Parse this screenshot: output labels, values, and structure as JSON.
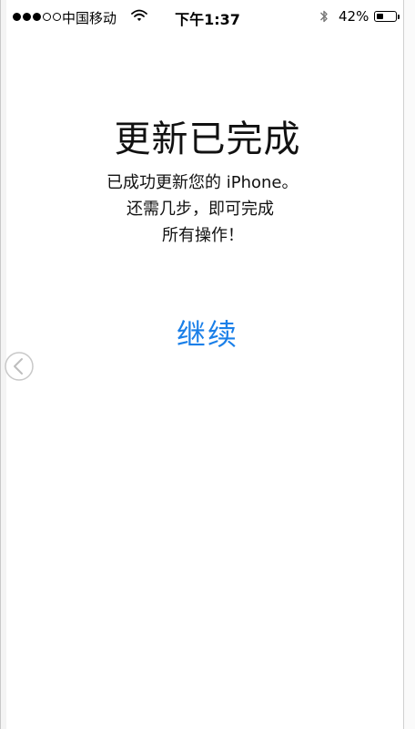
{
  "status_bar": {
    "signal_filled": 3,
    "signal_total": 5,
    "carrier": "中国移动",
    "time": "下午1:37",
    "battery_percent_label": "42%",
    "battery_level": 0.42
  },
  "setup": {
    "title": "更新已完成",
    "message_lines": [
      "已成功更新您的 iPhone。",
      "还需几步，即可完成",
      "所有操作！"
    ],
    "continue_label": "继续"
  },
  "colors": {
    "accent": "#1a7fe8",
    "text": "#111111",
    "background": "#ffffff"
  },
  "icons": {
    "wifi": "wifi-icon",
    "bluetooth": "bluetooth-icon",
    "battery": "battery-icon",
    "back": "circle-chevron-left-icon"
  }
}
